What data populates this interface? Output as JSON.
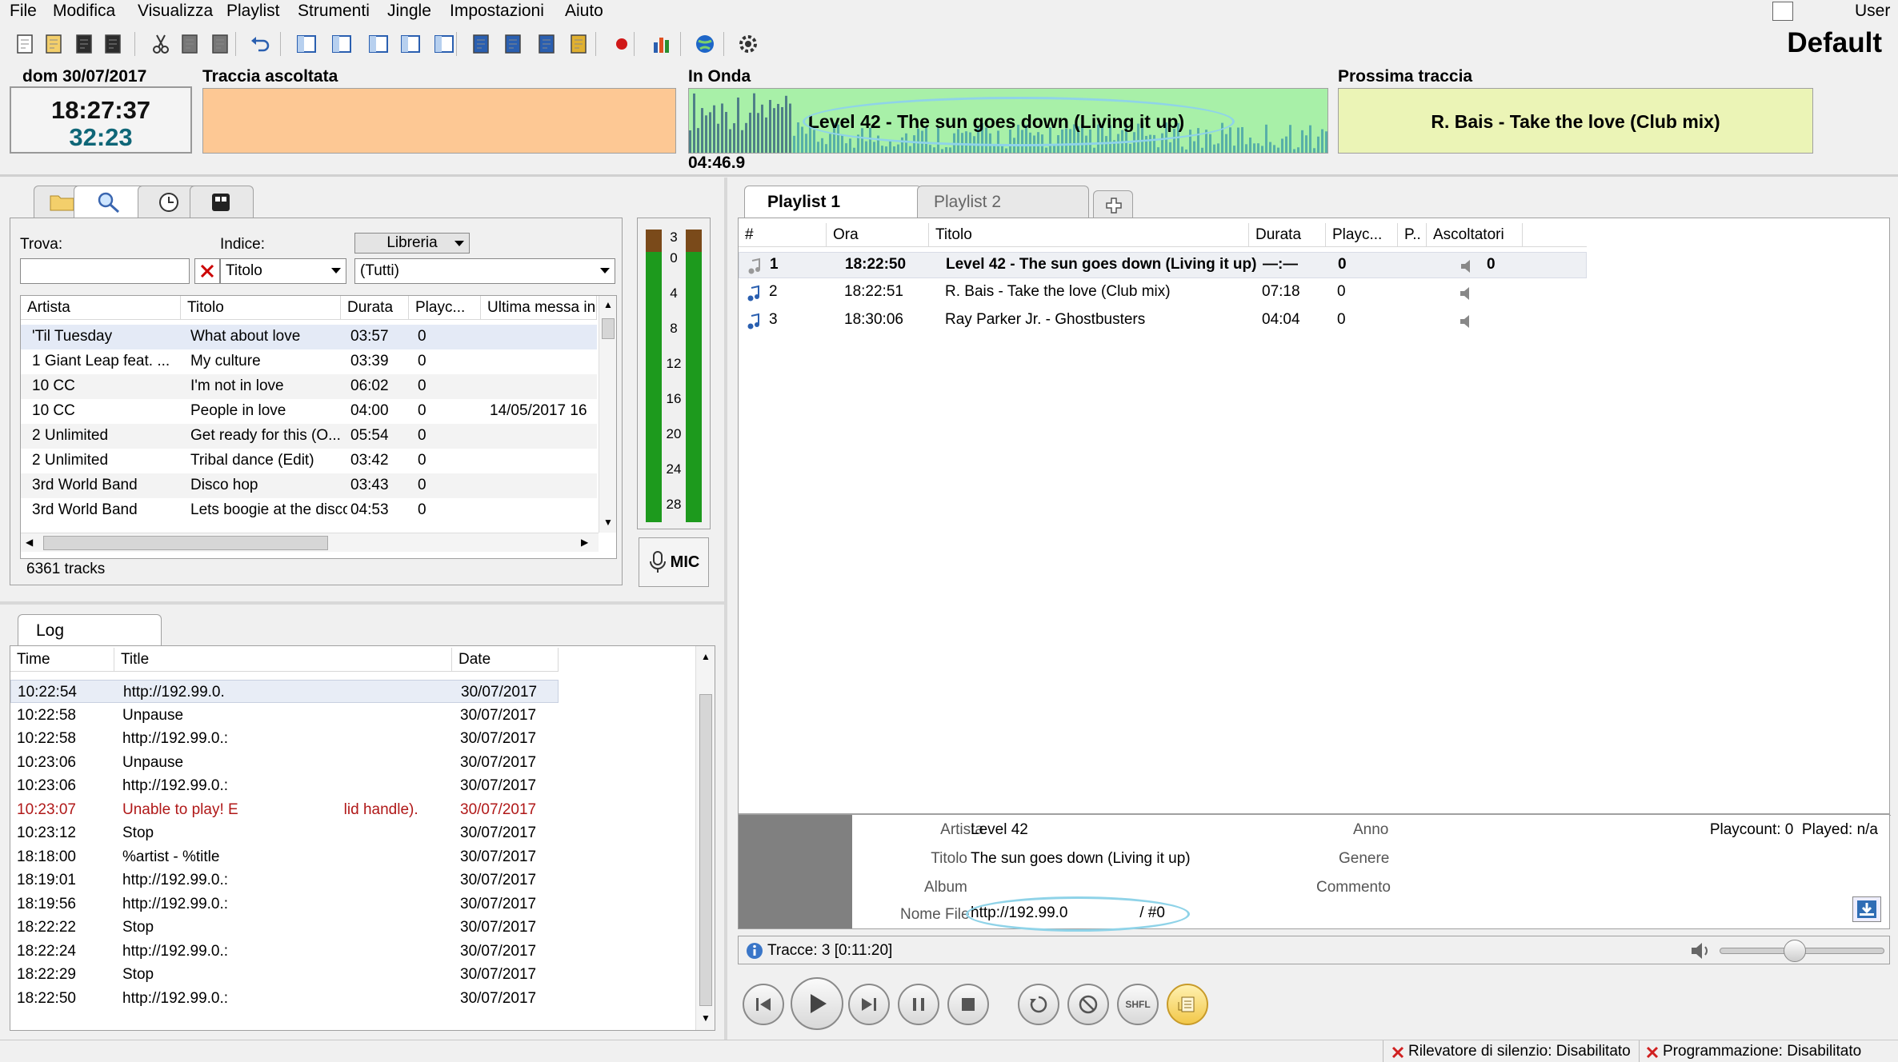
{
  "menu": [
    "File",
    "Modifica",
    "Visualizza",
    "Playlist",
    "Strumenti",
    "Jingle",
    "Impostazioni",
    "Aiuto"
  ],
  "user_label": "User",
  "profile_name": "Default",
  "toolbar_icons": [
    "new-file-icon",
    "open-folder-icon",
    "save-icon",
    "save-all-icon",
    "cut-icon",
    "copy-icon",
    "paste-icon",
    "undo-icon",
    "layout-1-icon",
    "layout-2-icon",
    "layout-3-icon",
    "layout-4-icon",
    "layout-5-icon",
    "add-track-icon",
    "insert-icon",
    "import-icon",
    "folder-add-icon",
    "record-icon",
    "stats-icon",
    "globe-icon",
    "settings-icon"
  ],
  "date_label": "dom 30/07/2017",
  "clock_time": "18:27:37",
  "clock_elapsed": "32:23",
  "previous": {
    "header": "Traccia ascoltata",
    "text": ""
  },
  "on_air": {
    "header": "In Onda",
    "text": "Level 42 - The sun goes down (Living it up)",
    "time": "04:46.9"
  },
  "next": {
    "header": "Prossima traccia",
    "text": "R. Bais - Take the love (Club mix)"
  },
  "library": {
    "search_label": "Trova:",
    "index_label": "Indice:",
    "source_combo": "Libreria",
    "index_combo": "Titolo",
    "filter_combo": "(Tutti)",
    "columns": [
      "Artista",
      "Titolo",
      "Durata",
      "Playc...",
      "Ultima messa in"
    ],
    "rows": [
      [
        "'Til Tuesday",
        "What about love",
        "03:57",
        "0",
        ""
      ],
      [
        "1 Giant Leap feat. ...",
        "My culture",
        "03:39",
        "0",
        ""
      ],
      [
        "10 CC",
        "I'm not in love",
        "06:02",
        "0",
        ""
      ],
      [
        "10 CC",
        "People in love",
        "04:00",
        "0",
        "14/05/2017 16"
      ],
      [
        "2 Unlimited",
        "Get ready for this (O...",
        "05:54",
        "0",
        ""
      ],
      [
        "2 Unlimited",
        "Tribal dance (Edit)",
        "03:42",
        "0",
        ""
      ],
      [
        "3rd World Band",
        "Disco hop",
        "03:43",
        "0",
        ""
      ],
      [
        "3rd World Band",
        "Lets boogie at the disco",
        "04:53",
        "0",
        ""
      ]
    ],
    "track_count": "6361 tracks"
  },
  "vu_scale": [
    "3",
    "0",
    "4",
    "8",
    "12",
    "16",
    "20",
    "24",
    "28"
  ],
  "mic_label": "MIC",
  "log": {
    "tab_label": "Log",
    "columns": [
      "Time",
      "Title",
      "Date"
    ],
    "rows": [
      {
        "time": "10:22:54",
        "title": "http://192.99.0.",
        "date": "30/07/2017",
        "error": false
      },
      {
        "time": "10:22:58",
        "title": "Unpause",
        "date": "30/07/2017",
        "error": false
      },
      {
        "time": "10:22:58",
        "title": "http://192.99.0.:",
        "date": "30/07/2017",
        "error": false
      },
      {
        "time": "10:23:06",
        "title": "Unpause",
        "date": "30/07/2017",
        "error": false
      },
      {
        "time": "10:23:06",
        "title": "http://192.99.0.:",
        "date": "30/07/2017",
        "error": false
      },
      {
        "time": "10:23:07",
        "title": "Unable to play! E                         lid handle).",
        "date": "30/07/2017",
        "error": true
      },
      {
        "time": "10:23:12",
        "title": "Stop",
        "date": "30/07/2017",
        "error": false
      },
      {
        "time": "18:18:00",
        "title": "%artist - %title",
        "date": "30/07/2017",
        "error": false
      },
      {
        "time": "18:19:01",
        "title": "http://192.99.0.:",
        "date": "30/07/2017",
        "error": false
      },
      {
        "time": "18:19:56",
        "title": "http://192.99.0.:",
        "date": "30/07/2017",
        "error": false
      },
      {
        "time": "18:22:22",
        "title": "Stop",
        "date": "30/07/2017",
        "error": false
      },
      {
        "time": "18:22:24",
        "title": "http://192.99.0.:",
        "date": "30/07/2017",
        "error": false
      },
      {
        "time": "18:22:29",
        "title": "Stop",
        "date": "30/07/2017",
        "error": false
      },
      {
        "time": "18:22:50",
        "title": "http://192.99.0.:",
        "date": "30/07/2017",
        "error": false
      }
    ]
  },
  "playlist": {
    "tabs": [
      "Playlist 1",
      "Playlist 2"
    ],
    "columns": [
      "#",
      "Ora",
      "Titolo",
      "Durata",
      "Playc...",
      "P..",
      "Ascoltatori"
    ],
    "rows": [
      {
        "n": "1",
        "ora": "18:22:50",
        "titolo": "Level 42 - The sun goes down (Living it up)",
        "durata": "—:—",
        "playc": "0",
        "asc": "0",
        "bold": true
      },
      {
        "n": "2",
        "ora": "18:22:51",
        "titolo": "R. Bais - Take the love (Club mix)",
        "durata": "07:18",
        "playc": "0",
        "asc": "",
        "bold": false
      },
      {
        "n": "3",
        "ora": "18:30:06",
        "titolo": "Ray Parker Jr. - Ghostbusters",
        "durata": "04:04",
        "playc": "0",
        "asc": "",
        "bold": false
      }
    ]
  },
  "info": {
    "artista_label": "Artista",
    "artista": "Level 42",
    "titolo_label": "Titolo",
    "titolo": "The sun goes down (Living it up)",
    "album_label": "Album",
    "album": "",
    "nomefile_label": "Nome File",
    "nomefile": "http://192.99.0                 / #0",
    "anno_label": "Anno",
    "genere_label": "Genere",
    "commento_label": "Commento",
    "playcount": "Playcount: 0  Played: n/a"
  },
  "tracks_summary": "Tracce: 3 [0:11:20]",
  "volume_level": 0.45,
  "status": {
    "silence": "Rilevatore di silenzio: Disabilitato",
    "scheduler": "Programmazione: Disabilitato"
  },
  "colors": {
    "onair_bg": "#a8f0a8",
    "prev_bg": "#fdc894",
    "next_bg": "#ebf4b6",
    "error_text": "#b01818",
    "vu_green": "#1d9a1d"
  }
}
